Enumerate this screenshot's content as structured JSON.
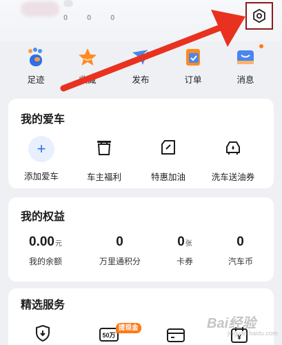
{
  "header": {
    "blurred_stats": [
      "0",
      "0",
      "0"
    ]
  },
  "quick_actions": [
    {
      "label": "足迹",
      "icon": "footprint-icon"
    },
    {
      "label": "收藏",
      "icon": "star-icon"
    },
    {
      "label": "发布",
      "icon": "publish-icon"
    },
    {
      "label": "订单",
      "icon": "order-icon"
    },
    {
      "label": "消息",
      "icon": "message-icon"
    }
  ],
  "my_car": {
    "title": "我的爱车",
    "items": [
      {
        "label": "添加爱车",
        "icon": "plus-icon"
      },
      {
        "label": "车主福利",
        "icon": "gift-pot-icon"
      },
      {
        "label": "特惠加油",
        "icon": "fuel-card-icon"
      },
      {
        "label": "洗车送油券",
        "icon": "car-wash-icon"
      }
    ]
  },
  "my_rights": {
    "title": "我的权益",
    "items": [
      {
        "value": "0.00",
        "unit": "元",
        "label": "我的余额"
      },
      {
        "value": "0",
        "unit": "",
        "label": "万里通积分"
      },
      {
        "value": "0",
        "unit": "张",
        "label": "卡券"
      },
      {
        "value": "0",
        "unit": "",
        "label": "汽车币"
      }
    ]
  },
  "services": {
    "title": "精选服务",
    "badge": "提现金",
    "items": [
      {
        "icon": "shield-icon"
      },
      {
        "icon": "fifty-icon",
        "text": "50万"
      },
      {
        "icon": "card-icon"
      },
      {
        "icon": "calendar-yuan-icon",
        "text": "¥"
      }
    ]
  },
  "watermark": {
    "text": "Bai经验",
    "sub": "jingyan.baidu.com"
  },
  "colors": {
    "accent": "#2f6fe6",
    "annotation": "#e8321f",
    "orange": "#ff7a18",
    "background": "#eef0f4"
  }
}
